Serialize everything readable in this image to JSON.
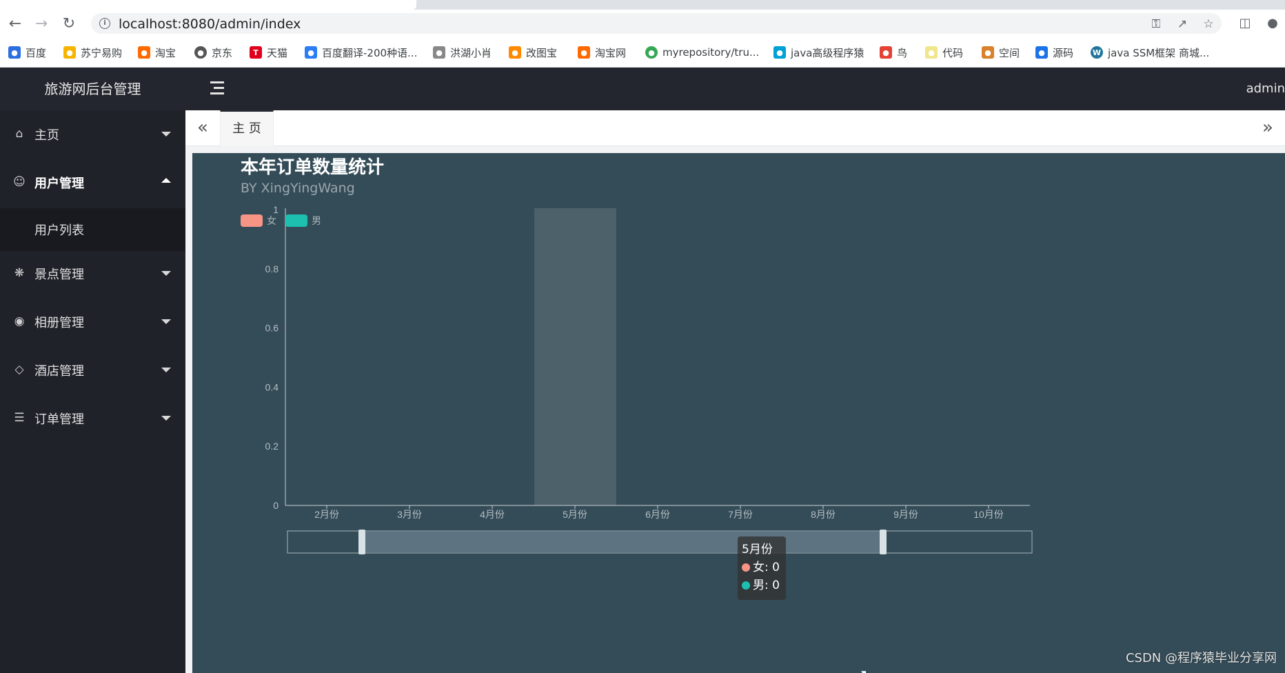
{
  "browser": {
    "url": "localhost:8080/admin/index",
    "bookmarks": [
      "百度",
      "苏宁易购",
      "淘宝",
      "京东",
      "天猫",
      "百度翻译-200种语...",
      "洪湖小肖",
      "改图宝",
      "淘宝网",
      "myrepository/tru...",
      "java高级程序猿",
      "鸟",
      "代码",
      "空间",
      "源码",
      "java SSM框架 商城..."
    ]
  },
  "app": {
    "brand": "旅游网后台管理",
    "user": "admin",
    "menu": [
      {
        "label": "主页",
        "icon": "home-icon",
        "state": "collapsed"
      },
      {
        "label": "用户管理",
        "icon": "user-icon",
        "state": "expanded"
      },
      {
        "label": "景点管理",
        "icon": "palm-tree-icon",
        "state": "collapsed"
      },
      {
        "label": "相册管理",
        "icon": "camera-icon",
        "state": "collapsed"
      },
      {
        "label": "酒店管理",
        "icon": "diamond-icon",
        "state": "collapsed"
      },
      {
        "label": "订单管理",
        "icon": "list-icon",
        "state": "collapsed"
      }
    ],
    "submenu": {
      "label": "用户列表"
    },
    "tabs": [
      {
        "label": "主 页",
        "active": true
      }
    ]
  },
  "colors": {
    "female": "#f69486",
    "male": "#1dbfae",
    "panel_bg": "#344c58",
    "sidebar_bg": "#20222a"
  },
  "chart_data": {
    "type": "bar",
    "title": "本年订单数量统计",
    "subtitle": "BY XingYingWang",
    "categories": [
      "2月份",
      "3月份",
      "4月份",
      "5月份",
      "6月份",
      "7月份",
      "8月份",
      "9月份",
      "10月份"
    ],
    "series": [
      {
        "name": "女",
        "values": [
          0,
          0,
          0,
          0,
          0,
          0,
          0,
          0,
          0
        ]
      },
      {
        "name": "男",
        "values": [
          0,
          0,
          0,
          0,
          0,
          0,
          0,
          0,
          0
        ]
      }
    ],
    "yticks": [
      "0",
      "0.2",
      "0.4",
      "0.6",
      "0.8",
      "1"
    ],
    "ylim": [
      0,
      1
    ],
    "legend": "top-left",
    "highlighted_category": "5月份",
    "datazoom": {
      "start": 0.1,
      "end": 0.8
    },
    "tooltip": {
      "title": "5月份",
      "rows": [
        {
          "label": "女: 0"
        },
        {
          "label": "男: 0"
        }
      ]
    }
  },
  "watermark": "CSDN @程序猿毕业分享网"
}
